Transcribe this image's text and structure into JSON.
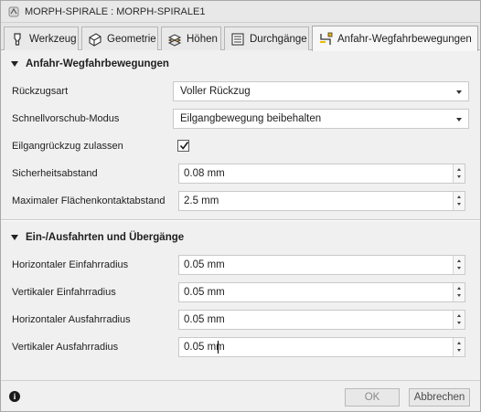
{
  "window": {
    "title": "MORPH-SPIRALE : MORPH-SPIRALE1"
  },
  "tabs": [
    {
      "label": "Werkzeug",
      "icon": "tool-icon",
      "active": false
    },
    {
      "label": "Geometrie",
      "icon": "geometry-icon",
      "active": false
    },
    {
      "label": "Höhen",
      "icon": "heights-icon",
      "active": false
    },
    {
      "label": "Durchgänge",
      "icon": "passes-icon",
      "active": false
    },
    {
      "label": "Anfahr-Wegfahrbewegungen",
      "icon": "linking-icon",
      "active": true
    }
  ],
  "sections": {
    "linking": {
      "title": "Anfahr-Wegfahrbewegungen",
      "retraction_label": "Rückzugsart",
      "retraction_value": "Voller Rückzug",
      "rapid_label": "Schnellvorschub-Modus",
      "rapid_value": "Eilgangbewegung beibehalten",
      "allow_rapid_label": "Eilgangrückzug zulassen",
      "allow_rapid_checked": true,
      "safe_distance_label": "Sicherheitsabstand",
      "safe_distance_value": "0.08 mm",
      "max_stay_down_label": "Maximaler Flächenkontaktabstand",
      "max_stay_down_value": "2.5 mm"
    },
    "leads": {
      "title": "Ein-/Ausfahrten und Übergänge",
      "h_lead_in_label": "Horizontaler Einfahrradius",
      "h_lead_in_value": "0.05 mm",
      "v_lead_in_label": "Vertikaler Einfahrradius",
      "v_lead_in_value": "0.05 mm",
      "h_lead_out_label": "Horizontaler Ausfahrradius",
      "h_lead_out_value": "0.05 mm",
      "v_lead_out_label": "Vertikaler Ausfahrradius",
      "v_lead_out_value": "0.05 mm"
    }
  },
  "footer": {
    "info_icon": "info-icon",
    "ok_label": "OK",
    "cancel_label": "Abbrechen"
  },
  "colors": {
    "panel_bg": "#f0f0f0",
    "tab_active_bg": "#f7f7f7",
    "input_border": "#c9c9c9"
  }
}
